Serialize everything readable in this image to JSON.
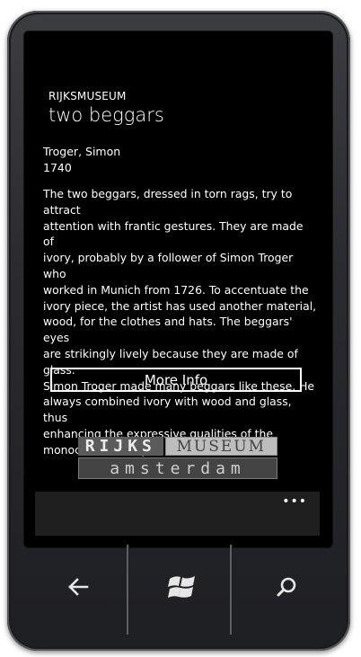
{
  "app": {
    "title": "RIJKSMUSEUM"
  },
  "page": {
    "title": "two beggars"
  },
  "artwork": {
    "artist": "Troger, Simon",
    "year": "1740",
    "description_lines": [
      "The two beggars, dressed in torn rags, try to attract",
      "attention with frantic gestures. They are made of",
      "ivory, probably by a follower of Simon Troger who",
      "worked in Munich from 1726. To accentuate the",
      "ivory piece, the artist has used another material,",
      "wood, for the clothes and hats. The beggars' eyes",
      "are strikingly lively because they are made of glass.",
      "Simon Troger made many beggars like these. He",
      "always combined ivory with wood and glass, thus",
      "enhancing the expressive qualities of the",
      "monochrome ivory."
    ]
  },
  "buttons": {
    "more_info": "More Info"
  },
  "logo": {
    "word1": "RIJKS",
    "word2": "MUSEUM",
    "word3": "amsterdam"
  },
  "appbar": {
    "more_label": "•••"
  },
  "hardware": {
    "back": "back-icon",
    "start": "windows-icon",
    "search": "search-icon"
  },
  "colors": {
    "background": "#000000",
    "text": "#ffffff",
    "appbar": "#1f1f1f"
  }
}
